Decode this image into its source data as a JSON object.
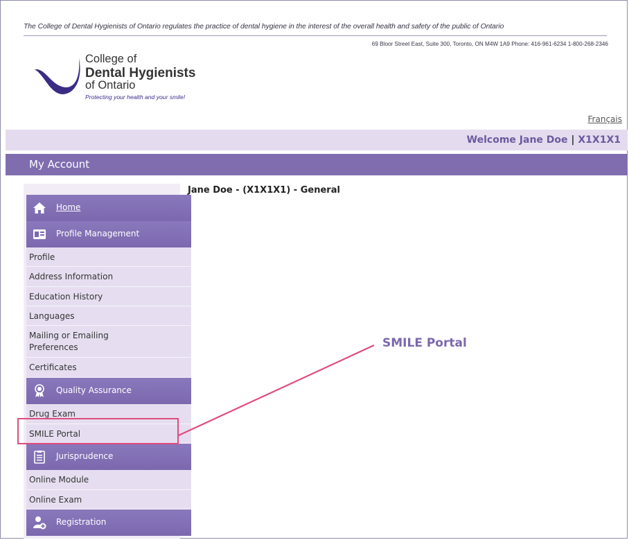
{
  "header": {
    "tagline": "The College of Dental Hygienists of Ontario regulates the practice of dental hygiene in the interest of the overall health and safety of the public of Ontario",
    "address": "69 Bloor Street East, Suite 300, Toronto, ON M4W 1A9  Phone: 416-961-6234  1-800-268-2346",
    "logo": {
      "line1": "College of",
      "line2": "Dental Hygienists",
      "line3": "of Ontario",
      "tagline": "Protecting your health and your smile!"
    },
    "language_link": "Français"
  },
  "welcome": {
    "greeting": "Welcome Jane Doe",
    "separator": "|",
    "registration_number": "X1X1X1"
  },
  "account_bar": {
    "title": "My Account"
  },
  "sidebar": {
    "home": {
      "label": "Home",
      "icon": "home-icon"
    },
    "profile_management": {
      "label": "Profile Management",
      "icon": "profile-card-icon",
      "items": [
        "Profile",
        "Address Information",
        "Education History",
        "Languages",
        "Mailing or Emailing Preferences",
        "Certificates"
      ]
    },
    "quality_assurance": {
      "label": "Quality Assurance",
      "icon": "award-ribbon-icon",
      "items": [
        "Drug Exam",
        "SMILE Portal"
      ]
    },
    "jurisprudence": {
      "label": "Jurisprudence",
      "icon": "clipboard-icon",
      "items": [
        "Online Module",
        "Online Exam"
      ]
    },
    "registration": {
      "label": "Registration",
      "icon": "add-user-icon"
    }
  },
  "main": {
    "member_title": "Jane Doe - (X1X1X1) - General"
  },
  "annotation": {
    "callout_label": "SMILE Portal",
    "highlight_color": "#e04a7c"
  },
  "colors": {
    "accent": "#7b68ae",
    "sidebar_bg": "#f1ecf5",
    "welcome_bar": "#e4dcee"
  }
}
